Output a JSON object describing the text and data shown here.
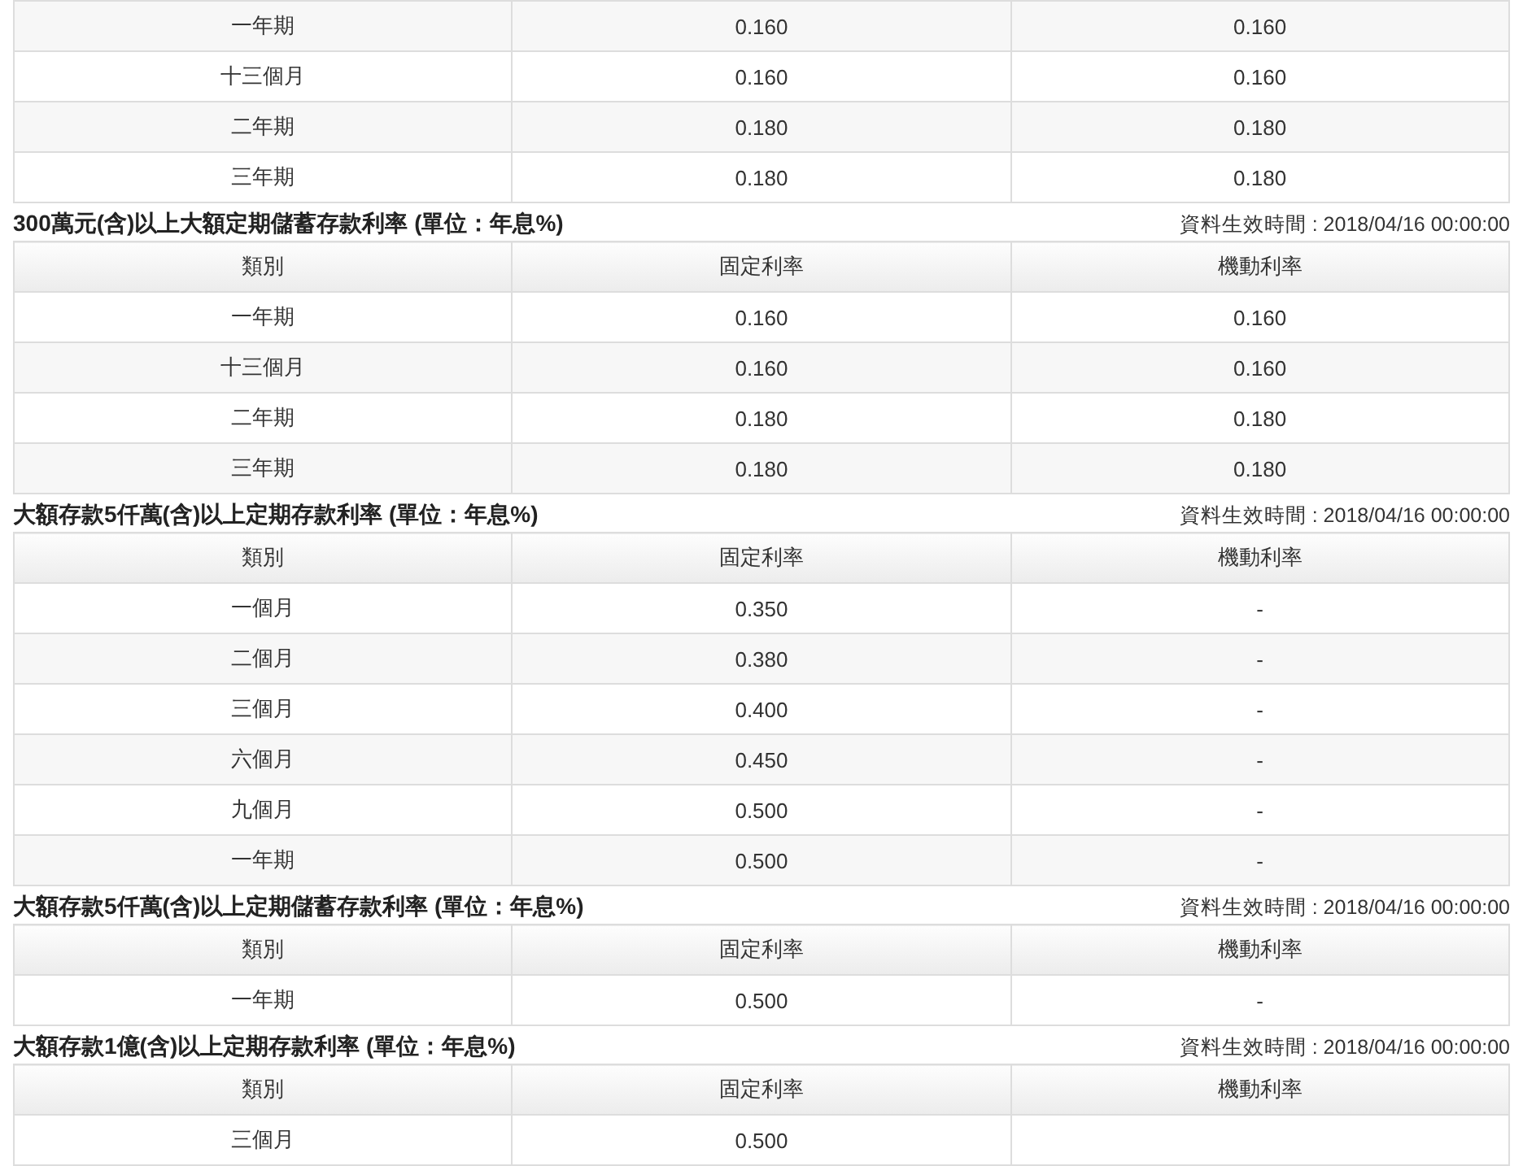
{
  "sections": [
    {
      "rows": [
        [
          "一年期",
          "0.160",
          "0.160"
        ],
        [
          "十三個月",
          "0.160",
          "0.160"
        ],
        [
          "二年期",
          "0.180",
          "0.180"
        ],
        [
          "三年期",
          "0.180",
          "0.180"
        ]
      ]
    },
    {
      "title": "300萬元(含)以上大額定期儲蓄存款利率 (單位：年息%)",
      "effective": "資料生效時間 : 2018/04/16 00:00:00",
      "columns": [
        "類別",
        "固定利率",
        "機動利率"
      ],
      "rows": [
        [
          "一年期",
          "0.160",
          "0.160"
        ],
        [
          "十三個月",
          "0.160",
          "0.160"
        ],
        [
          "二年期",
          "0.180",
          "0.180"
        ],
        [
          "三年期",
          "0.180",
          "0.180"
        ]
      ]
    },
    {
      "title": "大額存款5仟萬(含)以上定期存款利率 (單位：年息%)",
      "effective": "資料生效時間 : 2018/04/16 00:00:00",
      "columns": [
        "類別",
        "固定利率",
        "機動利率"
      ],
      "rows": [
        [
          "一個月",
          "0.350",
          "-"
        ],
        [
          "二個月",
          "0.380",
          "-"
        ],
        [
          "三個月",
          "0.400",
          "-"
        ],
        [
          "六個月",
          "0.450",
          "-"
        ],
        [
          "九個月",
          "0.500",
          "-"
        ],
        [
          "一年期",
          "0.500",
          "-"
        ]
      ]
    },
    {
      "title": "大額存款5仟萬(含)以上定期儲蓄存款利率 (單位：年息%)",
      "effective": "資料生效時間 : 2018/04/16 00:00:00",
      "columns": [
        "類別",
        "固定利率",
        "機動利率"
      ],
      "rows": [
        [
          "一年期",
          "0.500",
          "-"
        ]
      ]
    },
    {
      "title": "大額存款1億(含)以上定期存款利率 (單位：年息%)",
      "effective": "資料生效時間 : 2018/04/16 00:00:00",
      "columns": [
        "類別",
        "固定利率",
        "機動利率"
      ],
      "rows": [
        [
          "三個月",
          "0.500"
        ]
      ]
    }
  ]
}
